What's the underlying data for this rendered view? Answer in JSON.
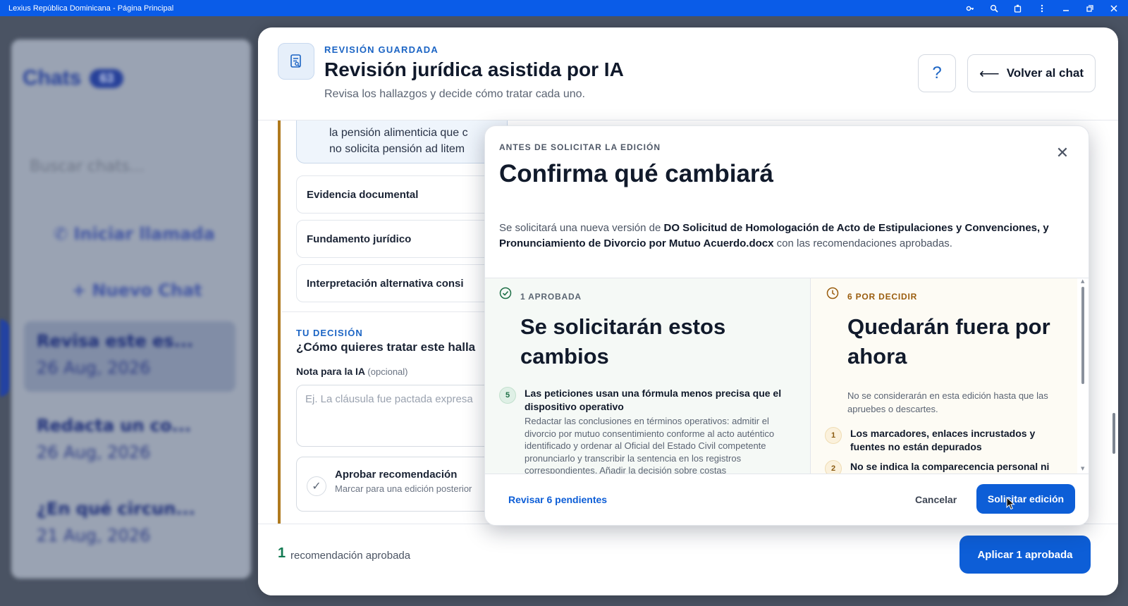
{
  "window": {
    "title": "Lexius República Dominicana - Página Principal"
  },
  "background": {
    "chats_title": "Chats",
    "chats_count": "63",
    "search_placeholder": "Buscar chats...",
    "call_button": "Iniciar llamada",
    "new_chat_button": "+ Nuevo Chat",
    "chat_items": [
      {
        "title": "Revisa este es...",
        "date": "26 Aug, 2026"
      },
      {
        "title": "Redacta un co...",
        "date": "26 Aug, 2026"
      },
      {
        "title": "¿En qué circun...",
        "date": "21 Aug, 2026"
      }
    ]
  },
  "panel": {
    "kicker": "REVISIÓN GUARDADA",
    "title": "Revisión jurídica asistida por IA",
    "subtitle": "Revisa los hallazgos y decide cómo tratar cada uno.",
    "help_label": "?",
    "back_arrow": "⟵",
    "back_label": "Volver al chat",
    "quote_line_1": "la pensión alimenticia que c",
    "quote_line_2": "no solicita pensión ad litem",
    "sections": [
      "Evidencia documental",
      "Fundamento jurídico",
      "Interpretación alternativa consi"
    ],
    "decision_kicker": "TU DECISIÓN",
    "decision_question": "¿Cómo quieres tratar este halla",
    "note_label": "Nota para la IA",
    "note_optional": "(opcional)",
    "note_placeholder": "Ej. La cláusula fue pactada expresa",
    "approve_check": "✓",
    "approve_title": "Aprobar recomendación",
    "approve_sub": "Marcar para una edición posterior",
    "footer_count": "1",
    "footer_text": "recomendación aprobada",
    "apply_button": "Aplicar 1 aprobada"
  },
  "dialog": {
    "kicker": "ANTES DE SOLICITAR LA EDICIÓN",
    "title": "Confirma qué cambiará",
    "close_glyph": "✕",
    "desc_prefix": "Se solicitará una nueva versión de ",
    "desc_document": "DO Solicitud de Homologación de Acto de Estipulaciones y Convenciones, y Pronunciamiento de Divorcio por Mutuo Acuerdo.docx",
    "desc_suffix": " con las recomendaciones aprobadas.",
    "approved": {
      "header": "1 APROBADA",
      "title": "Se solicitarán estos cambios",
      "items": [
        {
          "number": "5",
          "title": "Las peticiones usan una fórmula menos precisa que el dispositivo operativo",
          "description": "Redactar las conclusiones en términos operativos: admitir el divorcio por mutuo consentimiento conforme al acto auténtico identificado y ordenar al Oficial del Estado Civil competente pronunciarlo y transcribir la sentencia en los registros correspondientes. Añadir la decisión sobre costas"
        }
      ]
    },
    "pending": {
      "header": "6 POR DECIDIR",
      "title": "Quedarán fuera por ahora",
      "intro": "No se considerarán en esta edición hasta que las apruebes o descartes.",
      "items": [
        {
          "number": "1",
          "title": "Los marcadores, enlaces incrustados y fuentes no están depurados"
        },
        {
          "number": "2",
          "title": "No se indica la comparecencia personal ni"
        }
      ]
    },
    "review_button": "Revisar 6 pendientes",
    "cancel_button": "Cancelar",
    "request_button": "Solicitar edición"
  },
  "colors": {
    "accent": "#0d5ed7",
    "approved_green": "#1d6f46",
    "pending_amber": "#9a5d0e",
    "titlebar": "#0a5ce8"
  }
}
